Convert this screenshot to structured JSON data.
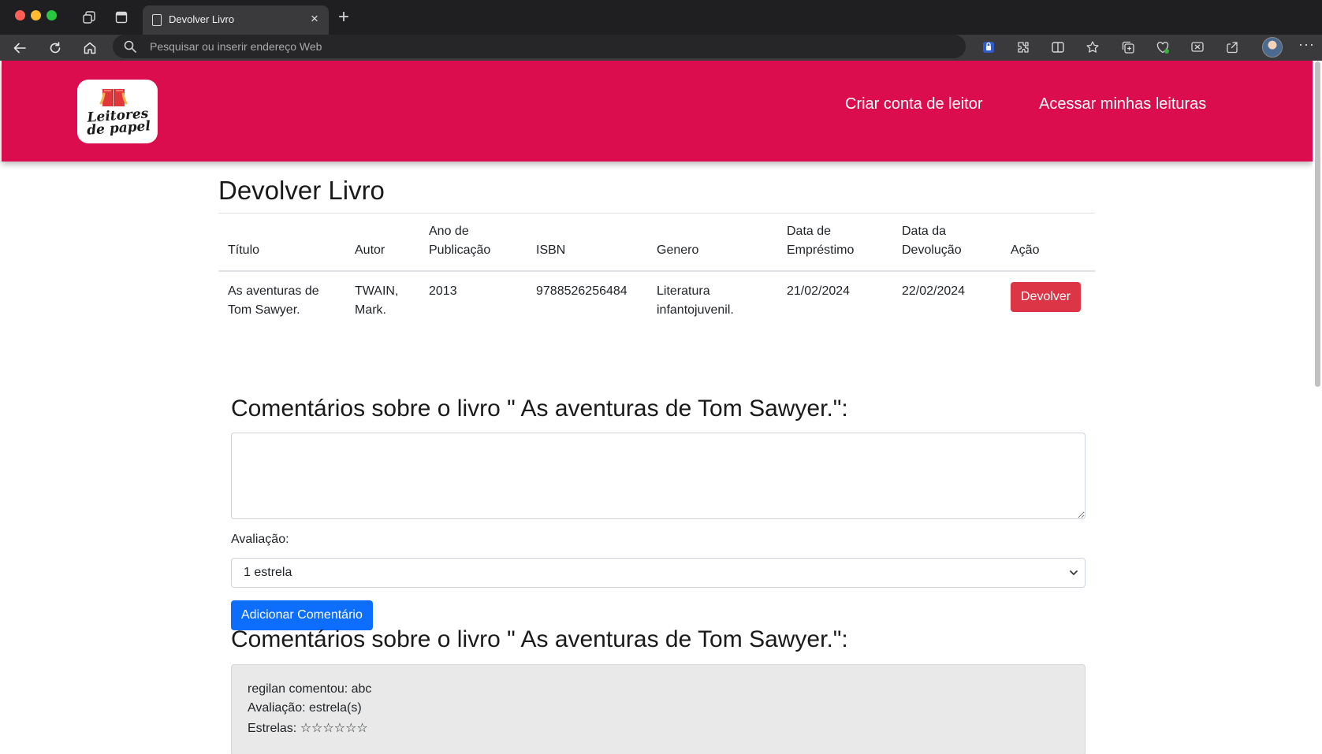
{
  "browser": {
    "tab_title": "Devolver Livro",
    "tab_close": "×",
    "new_tab": "+",
    "address_placeholder": "Pesquisar ou inserir endereço Web",
    "more": "···"
  },
  "header": {
    "logo_line1": "Leitores",
    "logo_line2": "de papel",
    "nav": {
      "create_account": "Criar conta de leitor",
      "my_readings": "Acessar minhas leituras"
    },
    "brand_color": "#dc0d4f"
  },
  "main": {
    "title": "Devolver Livro",
    "table": {
      "headers": [
        "Título",
        "Autor",
        "Ano de Publicação",
        "ISBN",
        "Genero",
        "Data de Empréstimo",
        "Data da Devolução",
        "Ação"
      ],
      "rows": [
        {
          "titulo": "As aventuras de Tom Sawyer.",
          "autor": "TWAIN, Mark.",
          "ano": "2013",
          "isbn": "9788526256484",
          "genero": "Literatura infantojuvenil.",
          "emprestimo": "21/02/2024",
          "devolucao": "22/02/2024",
          "acao": "Devolver"
        }
      ]
    },
    "comment_form": {
      "heading": "Comentários sobre o livro \" As aventuras de Tom Sawyer.\":",
      "textarea_value": "",
      "rating_label": "Avaliação:",
      "rating_selected": "1 estrela",
      "submit_label": "Adicionar Comentário"
    },
    "comments": {
      "heading": "Comentários sobre o livro \" As aventuras de Tom Sawyer.\":",
      "items": [
        {
          "line1": "regilan comentou: abc",
          "line2": "Avaliação: estrela(s)",
          "line3": "Estrelas: ☆☆☆☆☆☆"
        }
      ]
    }
  },
  "colors": {
    "danger": "#dc3545",
    "primary": "#0d6efd"
  }
}
